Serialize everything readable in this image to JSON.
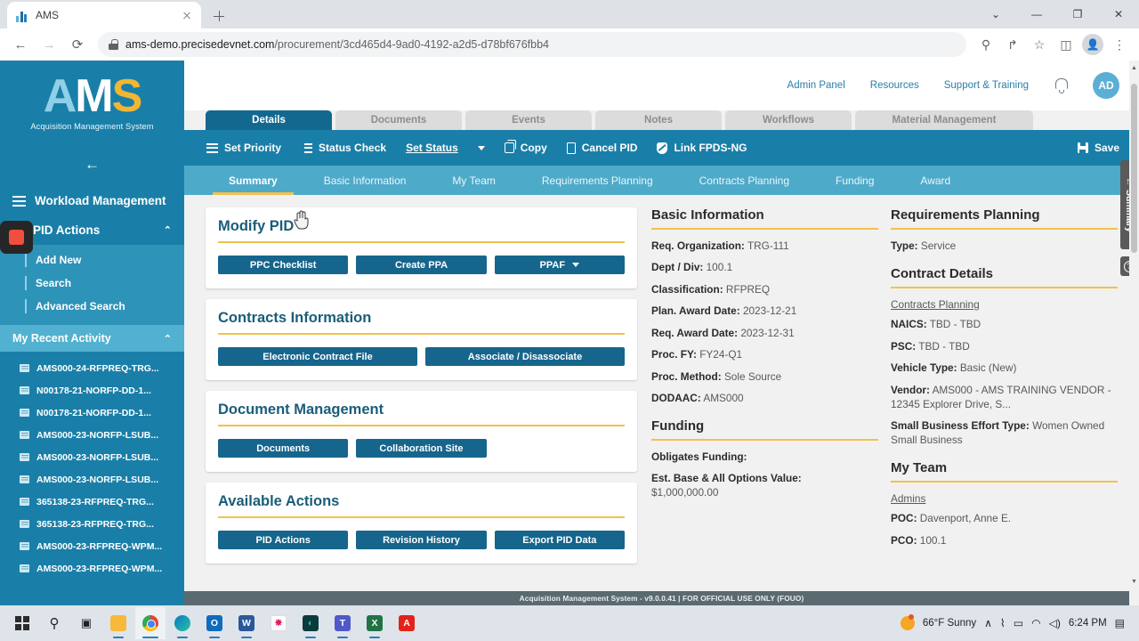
{
  "browser": {
    "tab_title": "AMS",
    "url_prefix": "ams-demo.precisedevnet.com",
    "url_path": "/procurement/3cd465d4-9ad0-4192-a2d5-d78bf676fbb4",
    "new_tab_label": "+",
    "close_tab_label": "",
    "back_label": "←",
    "forward_label": "→",
    "reload_label": "⟳",
    "minimize_label": "—",
    "maximize_label": "❐",
    "close_label": "✕",
    "menu_label": "⋮",
    "profile_label": "●",
    "zoom_label": "⚲",
    "share_label": "↱",
    "bookmark_label": "☆",
    "sidepanel_label": "◫",
    "chevron_label": "⌄"
  },
  "sidebar": {
    "logo_a": "A",
    "logo_m": "M",
    "logo_s": "S",
    "logo_subtitle": "Acquisition Management System",
    "collapse_label": "←",
    "nav": [
      {
        "label": "Workload Management",
        "icon": "hamburger-icon",
        "chevron": ""
      },
      {
        "label": "PID Actions",
        "icon": "grid-icon",
        "chevron": "⌃"
      }
    ],
    "pid_submenu": [
      "Add New",
      "Search",
      "Advanced Search"
    ],
    "recent_header": "My Recent Activity",
    "recent_chevron": "⌃",
    "recent_items": [
      "AMS000-24-RFPREQ-TRG...",
      "N00178-21-NORFP-DD-1...",
      "N00178-21-NORFP-DD-1...",
      "AMS000-23-NORFP-LSUB...",
      "AMS000-23-NORFP-LSUB...",
      "AMS000-23-NORFP-LSUB...",
      "365138-23-RFPREQ-TRG...",
      "365138-23-RFPREQ-TRG...",
      "AMS000-23-RFPREQ-WPM...",
      "AMS000-23-RFPREQ-WPM..."
    ]
  },
  "topbar": {
    "links": [
      "Admin Panel",
      "Resources",
      "Support & Training"
    ],
    "avatar_initials": "AD"
  },
  "tabs": [
    {
      "label": "Details",
      "active": true
    },
    {
      "label": "Documents",
      "active": false
    },
    {
      "label": "Events",
      "active": false
    },
    {
      "label": "Notes",
      "active": false
    },
    {
      "label": "Workflows",
      "active": false
    },
    {
      "label": "Material Management",
      "active": false
    }
  ],
  "actionbar": {
    "set_priority": "Set Priority",
    "status_check": "Status Check",
    "set_status": "Set Status",
    "copy": "Copy",
    "cancel_pid": "Cancel PID",
    "link_fpds": "Link FPDS-NG",
    "save": "Save"
  },
  "subtabs": [
    {
      "label": "Summary",
      "active": true
    },
    {
      "label": "Basic Information",
      "active": false
    },
    {
      "label": "My Team",
      "active": false
    },
    {
      "label": "Requirements Planning",
      "active": false
    },
    {
      "label": "Contracts Planning",
      "active": false
    },
    {
      "label": "Funding",
      "active": false
    },
    {
      "label": "Award",
      "active": false
    }
  ],
  "cards": [
    {
      "title": "Modify PID",
      "buttons": [
        "PPC Checklist",
        "Create PPA",
        "PPAF"
      ],
      "has_caret_on_last": true
    },
    {
      "title": "Contracts Information",
      "buttons": [
        "Electronic Contract File",
        "Associate / Disassociate"
      ],
      "has_caret_on_last": false
    },
    {
      "title": "Document Management",
      "buttons": [
        "Documents",
        "Collaboration Site"
      ],
      "has_caret_on_last": false
    },
    {
      "title": "Available Actions",
      "buttons": [
        "PID Actions",
        "Revision History",
        "Export PID Data"
      ],
      "has_caret_on_last": false
    }
  ],
  "basic_information": {
    "title": "Basic Information",
    "rows": [
      {
        "label": "Req. Organization:",
        "value": "TRG-111"
      },
      {
        "label": "Dept / Div:",
        "value": "100.1"
      },
      {
        "label": "Classification:",
        "value": "RFPREQ"
      },
      {
        "label": "Plan. Award Date:",
        "value": "2023-12-21"
      },
      {
        "label": "Req. Award Date:",
        "value": "2023-12-31"
      },
      {
        "label": "Proc. FY:",
        "value": "FY24-Q1"
      },
      {
        "label": "Proc. Method:",
        "value": "Sole Source"
      },
      {
        "label": "DODAAC:",
        "value": "AMS000"
      }
    ]
  },
  "funding": {
    "title": "Funding",
    "rows": [
      {
        "label": "Obligates Funding:",
        "value": ""
      },
      {
        "label": "Est. Base & All Options Value:",
        "value": "$1,000,000.00"
      }
    ]
  },
  "requirements_planning": {
    "title": "Requirements Planning",
    "rows": [
      {
        "label": "Type:",
        "value": "Service"
      }
    ]
  },
  "contract_details": {
    "title": "Contract Details",
    "link": "Contracts Planning",
    "rows": [
      {
        "label": "NAICS:",
        "value": "TBD - TBD"
      },
      {
        "label": "PSC:",
        "value": "TBD - TBD"
      },
      {
        "label": "Vehicle Type:",
        "value": "Basic (New)"
      },
      {
        "label": "Vendor:",
        "value": "AMS000 - AMS TRAINING VENDOR - 12345 Explorer Drive, S..."
      },
      {
        "label": "Small Business Effort Type:",
        "value": "Women Owned Small Business"
      }
    ]
  },
  "my_team": {
    "title": "My Team",
    "link": "Admins",
    "rows": [
      {
        "label": "POC:",
        "value": "Davenport, Anne E."
      },
      {
        "label": "PCO:",
        "value": "100.1"
      }
    ]
  },
  "rail": {
    "summary_label": "Summary",
    "summary_arrow": "←",
    "help_label": "?"
  },
  "footer": {
    "text": "Acquisition Management System - v9.0.0.41 | FOR OFFICIAL USE ONLY (FOUO)"
  },
  "taskbar": {
    "search_label": "⚲",
    "taskview_label": "▣",
    "explorer_label": "▬",
    "apps": [
      {
        "name": "outlook",
        "letter": "O",
        "color": "#0f6cbd"
      },
      {
        "name": "word",
        "letter": "W",
        "color": "#2b579a"
      },
      {
        "name": "slack",
        "letter": "✸",
        "color": "#ffffff"
      },
      {
        "name": "teal-app",
        "letter": "◐",
        "color": "#0b3b3c"
      },
      {
        "name": "teams",
        "letter": "T",
        "color": "#5059c9"
      },
      {
        "name": "excel",
        "letter": "X",
        "color": "#217346"
      },
      {
        "name": "acrobat",
        "letter": "A",
        "color": "#e2231a"
      }
    ],
    "weather": "66°F  Sunny",
    "chevron": "∧",
    "mic_label": "⌇",
    "battery_label": "▭",
    "wifi_label": "◠",
    "volume_label": "◁)",
    "time": "6:24 PM",
    "notification_label": "▤"
  }
}
